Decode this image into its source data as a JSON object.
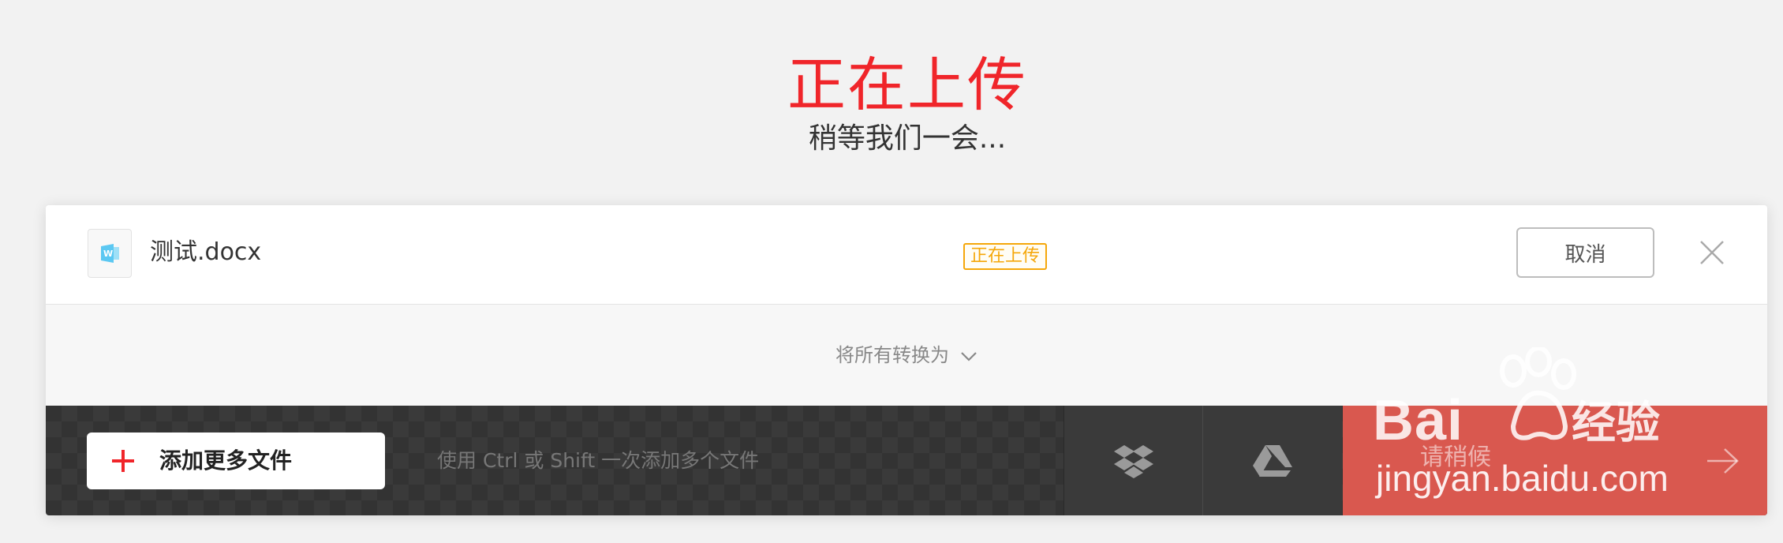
{
  "header": {
    "title": "正在上传",
    "subtitle": "稍等我们一会..."
  },
  "file": {
    "name": "测试.docx",
    "icon": "word-document-icon",
    "status": "正在上传",
    "cancel_label": "取消"
  },
  "convert": {
    "label": "将所有转换为"
  },
  "toolbar": {
    "add_files_label": "添加更多文件",
    "hint": "使用 Ctrl 或 Shift 一次添加多个文件",
    "wait_label": "请稍候"
  },
  "watermark": {
    "brand": "Bai",
    "brand_suffix": "经验",
    "url": "jingyan.baidu.com"
  },
  "colors": {
    "accent": "#f0252a",
    "status": "#f5a70a",
    "action_bar": "#333333",
    "wait_button": "#d9584f"
  }
}
